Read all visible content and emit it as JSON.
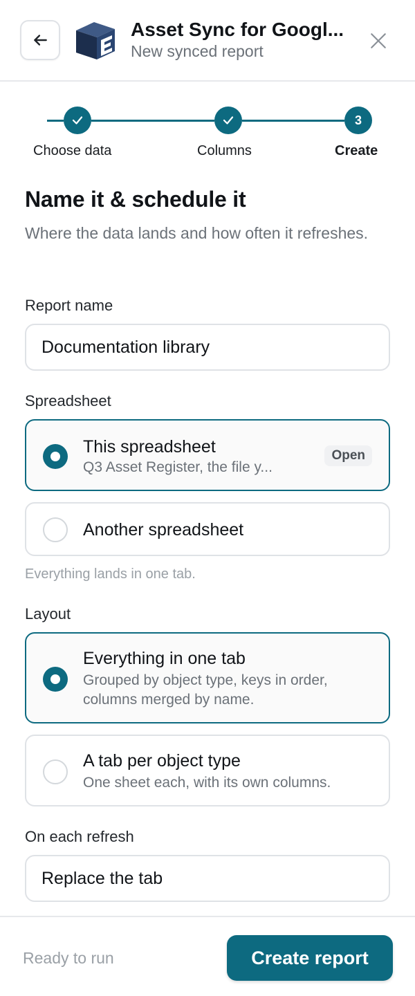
{
  "header": {
    "title": "Asset Sync for Googl...",
    "subtitle": "New synced report"
  },
  "stepper": {
    "steps": [
      {
        "label": "Choose data",
        "state": "done"
      },
      {
        "label": "Columns",
        "state": "done"
      },
      {
        "label": "Create",
        "state": "current",
        "number": "3"
      }
    ]
  },
  "section": {
    "title": "Name it & schedule it",
    "description": "Where the data lands and how often it refreshes."
  },
  "report_name": {
    "label": "Report name",
    "value": "Documentation library"
  },
  "spreadsheet": {
    "label": "Spreadsheet",
    "options": [
      {
        "title": "This spreadsheet",
        "description": "Q3 Asset Register, the file y...",
        "badge": "Open",
        "selected": true
      },
      {
        "title": "Another spreadsheet",
        "selected": false
      }
    ],
    "hint": "Everything lands in one tab."
  },
  "layout": {
    "label": "Layout",
    "options": [
      {
        "title": "Everything in one tab",
        "description": "Grouped by object type, keys in order, columns merged by name.",
        "selected": true
      },
      {
        "title": "A tab per object type",
        "description": "One sheet each, with its own columns.",
        "selected": false
      }
    ]
  },
  "refresh": {
    "label": "On each refresh",
    "value": "Replace the tab"
  },
  "footer": {
    "status": "Ready to run",
    "primary_label": "Create report"
  },
  "colors": {
    "accent": "#0d6a80",
    "border": "#dfe2e6",
    "muted_text": "#6b7178"
  }
}
